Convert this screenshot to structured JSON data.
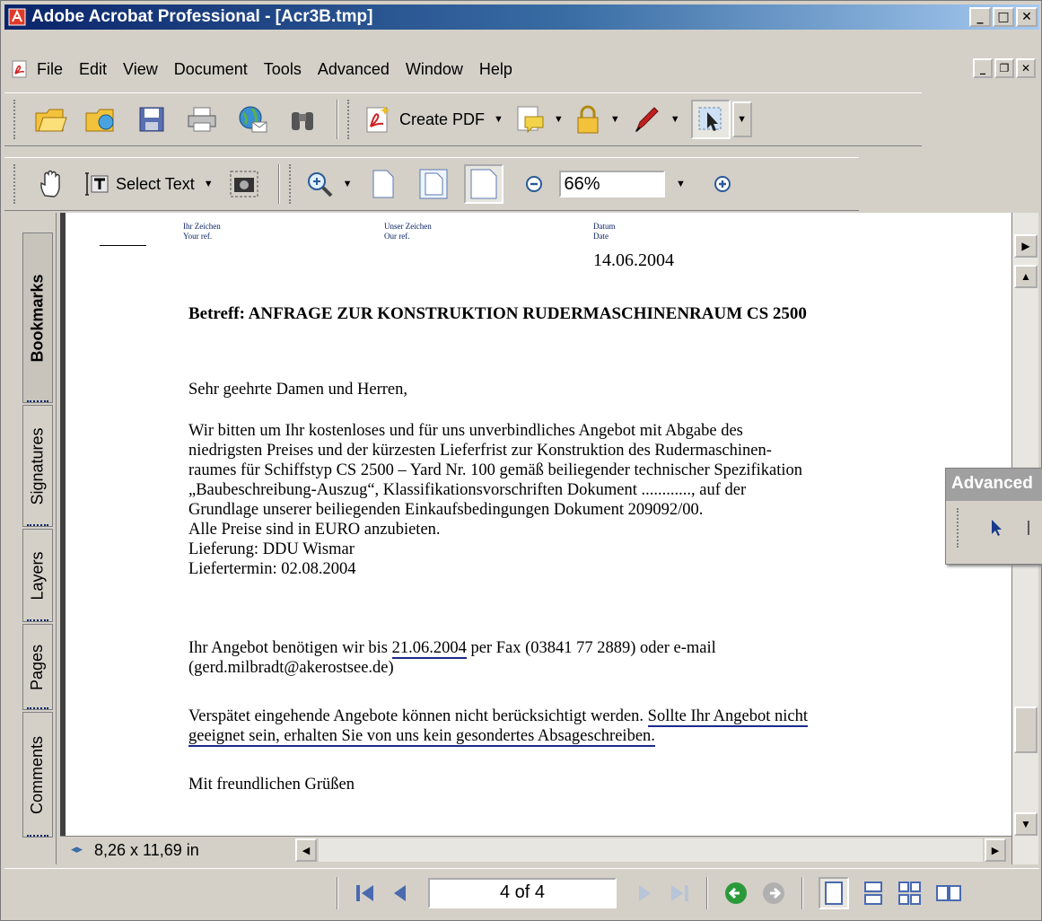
{
  "window": {
    "title": "Adobe Acrobat Professional - [Acr3B.tmp]"
  },
  "menu": {
    "items": [
      "File",
      "Edit",
      "View",
      "Document",
      "Tools",
      "Advanced",
      "Window",
      "Help"
    ]
  },
  "toolbar1": {
    "create_pdf_label": "Create PDF"
  },
  "toolbar2": {
    "select_text_label": "Select Text",
    "zoom_value": "66%"
  },
  "nav_tabs": {
    "bookmarks": "Bookmarks",
    "signatures": "Signatures",
    "layers": "Layers",
    "pages": "Pages",
    "comments": "Comments"
  },
  "document": {
    "ref_labels": {
      "ihr_zeichen": "Ihr Zeichen",
      "your_ref": "Your ref.",
      "unser_zeichen": "Unser Zeichen",
      "our_ref": "Our ref.",
      "datum": "Datum",
      "date": "Date"
    },
    "date_value": "14.06.2004",
    "betreff": "Betreff: ANFRAGE ZUR KONSTRUKTION RUDERMASCHINENRAUM CS 2500",
    "salutation": "Sehr geehrte Damen und Herren,",
    "body_lines": [
      "Wir bitten um Ihr kostenloses und für uns unverbindliches Angebot mit Abgabe des",
      "niedrigsten Preises und der kürzesten Lieferfrist zur Konstruktion des Rudermaschinen-",
      "raumes für Schiffstyp CS 2500 – Yard Nr. 100 gemäß beiliegender technischer Spezifikation",
      "„Baubeschreibung-Auszug“, Klassifikationsvorschriften Dokument ............, auf der",
      "Grundlage unserer beiliegenden Einkaufsbedingungen Dokument 209092/00.",
      "Alle Preise sind in EURO anzubieten.",
      "Lieferung: DDU Wismar",
      "Liefertermin: 02.08.2004"
    ],
    "offer_prefix": "Ihr Angebot benötigen wir bis ",
    "offer_date": "21.06.2004",
    "offer_suffix": " per Fax (03841 77 2889) oder e-mail",
    "offer_email": "(gerd.milbradt@akerostsee.de)",
    "late_prefix": "Verspätet eingehende Angebote können nicht berücksichtigt werden. ",
    "late_underlined_1": "Sollte Ihr Angebot nicht",
    "late_underlined_2": "geeignet sein, erhalten Sie von uns kein gesondertes Absageschreiben.",
    "closing": "Mit freundlichen Grüßen"
  },
  "page_size": "8,26 x 11,69 in",
  "page_nav": {
    "current": "4 of 4"
  },
  "advanced_toolbar": {
    "title": "Advanced"
  }
}
